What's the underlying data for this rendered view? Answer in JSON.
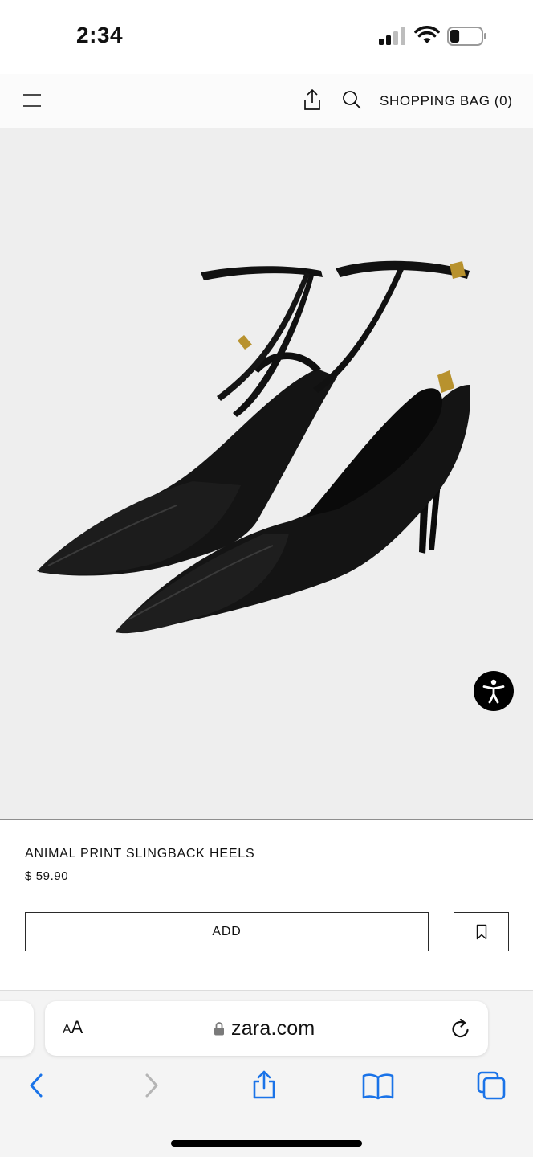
{
  "status_bar": {
    "time": "2:34",
    "icons": [
      "cellular-signal-icon",
      "wifi-icon",
      "battery-icon"
    ],
    "battery_level": 0.3
  },
  "header": {
    "icons": [
      "menu-icon",
      "share-icon",
      "search-icon"
    ],
    "bag_label": "SHOPPING BAG (0)"
  },
  "product": {
    "name": "ANIMAL PRINT SLINGBACK HEELS",
    "price": "$ 59.90",
    "add_label": "ADD",
    "icons": [
      "accessibility-icon",
      "bookmark-icon"
    ]
  },
  "browser": {
    "text_size_label_small": "A",
    "text_size_label_large": "A",
    "url": "zara.com",
    "icons": [
      "lock-icon",
      "reload-icon",
      "back-icon",
      "forward-icon",
      "share-icon",
      "bookmarks-icon",
      "tabs-icon"
    ]
  },
  "colors": {
    "accent_blue": "#1a73e8",
    "image_background": "#eeeeee",
    "text": "#111111"
  }
}
